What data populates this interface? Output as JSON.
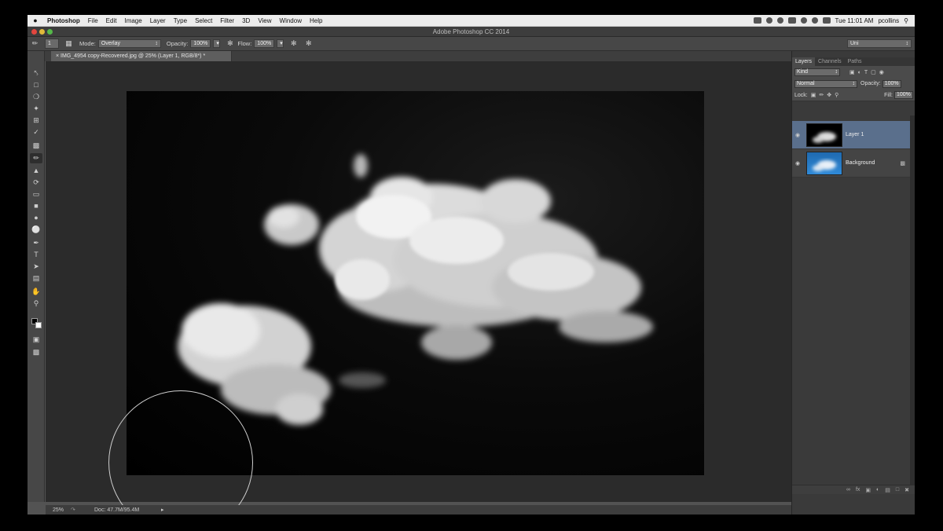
{
  "menubar": {
    "apple": "",
    "items": [
      "Photoshop",
      "File",
      "Edit",
      "Image",
      "Layer",
      "Type",
      "Select",
      "Filter",
      "3D",
      "View",
      "Window",
      "Help"
    ],
    "time": "Tue 11:01 AM",
    "user": "pcollins"
  },
  "window": {
    "title": "Adobe Photoshop CC 2014"
  },
  "options": {
    "brush_size": "1",
    "mode_label": "Mode:",
    "mode_value": "Overlay",
    "opacity_label": "Opacity:",
    "opacity_value": "100%",
    "flow_label": "Flow:",
    "flow_value": "100%",
    "workspace": "Uni"
  },
  "document": {
    "tab": "IMG_4954 copy-Recovered.jpg @ 25% (Layer 1, RGB/8*) *",
    "zoom": "25%",
    "doc_size": "Doc: 47.7M/95.4M"
  },
  "layers_panel": {
    "tabs": [
      "Layers",
      "Channels",
      "Paths"
    ],
    "filter": "Kind",
    "blend": "Normal",
    "opacity_label": "Opacity:",
    "opacity_value": "100%",
    "lock_label": "Lock:",
    "fill_label": "Fill:",
    "fill_value": "100%",
    "layers": [
      {
        "name": "Layer 1",
        "selected": true
      },
      {
        "name": "Background",
        "locked": true
      }
    ]
  },
  "colors": {
    "selected_layer": "#5a6f8c",
    "background_thumb": "#1f6ab0"
  },
  "icons": [
    "apple-icon",
    "brush-icon",
    "zoom-icon",
    "hand-icon",
    "eye-icon",
    "lock-icon",
    "fx-icon",
    "trash-icon"
  ]
}
